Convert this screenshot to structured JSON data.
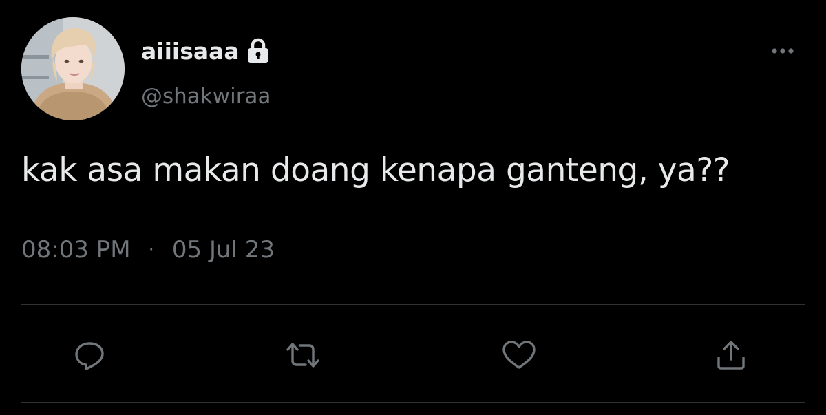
{
  "user": {
    "display_name": "aiiisaaa",
    "handle": "@shakwiraa",
    "protected_icon": "lock-icon",
    "avatar_icon": "avatar-photo"
  },
  "tweet": {
    "text": "kak asa makan doang kenapa ganteng, ya??",
    "time": "08:03 PM",
    "separator": "·",
    "date": "05 Jul 23"
  },
  "actions": [
    {
      "icon": "reply-icon"
    },
    {
      "icon": "retweet-icon"
    },
    {
      "icon": "like-icon"
    },
    {
      "icon": "share-icon"
    }
  ],
  "more_icon": "more-icon",
  "colors": {
    "background": "#000000",
    "primary_text": "#e7e9ea",
    "secondary_text": "#71767b",
    "divider": "#2f3336"
  }
}
